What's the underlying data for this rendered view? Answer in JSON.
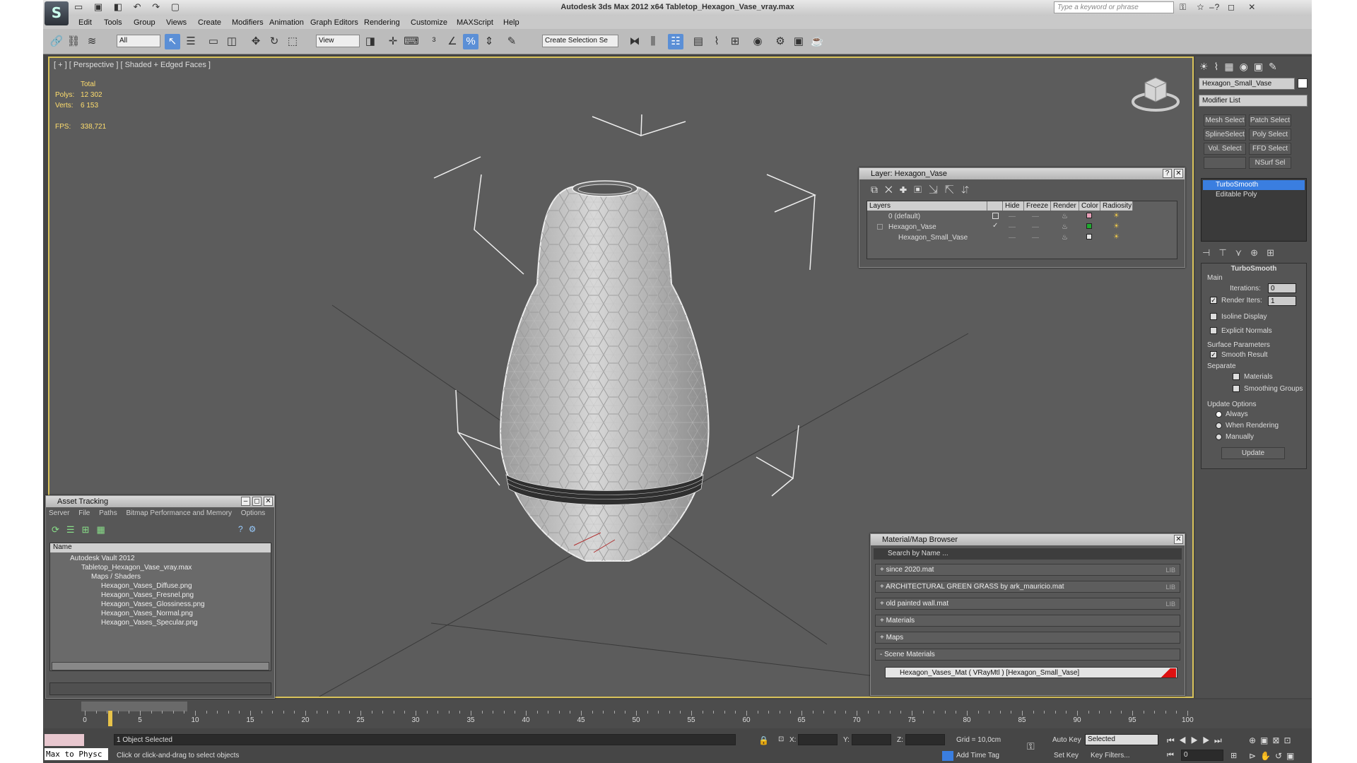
{
  "app": {
    "title": "Autodesk 3ds Max  2012 x64      Tabletop_Hexagon_Vase_vray.max",
    "search_placeholder": "Type a keyword or phrase",
    "logo_glyph": "S"
  },
  "menu": [
    "Edit",
    "Tools",
    "Group",
    "Views",
    "Create",
    "Modifiers",
    "Animation",
    "Graph Editors",
    "Rendering",
    "Customize",
    "MAXScript",
    "Help"
  ],
  "toolbar": {
    "selection_filter": "All",
    "reference_coord": "View",
    "named_selection": "Create Selection Se"
  },
  "viewport": {
    "label": "[ + ] [ Perspective ] [ Shaded + Edged Faces ]",
    "stats": {
      "total_label": "Total",
      "polys_label": "Polys:",
      "polys_value": "12 302",
      "verts_label": "Verts:",
      "verts_value": "6 153",
      "fps_label": "FPS:",
      "fps_value": "338,721"
    }
  },
  "command_panel": {
    "object_name": "Hexagon_Small_Vase",
    "modifier_list": "Modifier List",
    "buttons": [
      "Mesh Select",
      "Patch Select",
      "SplineSelect",
      "Poly Select",
      "Vol. Select",
      "FFD Select",
      "",
      "NSurf Sel"
    ],
    "stack": [
      "TurboSmooth",
      "Editable Poly"
    ],
    "turbosmooth": {
      "title": "TurboSmooth",
      "main": "Main",
      "iterations_label": "Iterations:",
      "iterations": "0",
      "render_iters_label": "Render Iters:",
      "render_iters": "1",
      "isoline": "Isoline Display",
      "explicit": "Explicit Normals",
      "surface_params": "Surface Parameters",
      "smooth_result": "Smooth Result",
      "separate": "Separate",
      "materials": "Materials",
      "smoothing_groups": "Smoothing Groups",
      "update_options": "Update Options",
      "always": "Always",
      "when_rendering": "When Rendering",
      "manually": "Manually",
      "update": "Update"
    }
  },
  "layer_window": {
    "title": "Layer: Hexagon_Vase",
    "columns": [
      "Layers",
      "",
      "Hide",
      "Freeze",
      "Render",
      "Color",
      "Radiosity"
    ],
    "rows": [
      {
        "name": "0 (default)",
        "color": "#e8a0b8"
      },
      {
        "name": "Hexagon_Vase",
        "color": "#1faa2f"
      },
      {
        "name": "Hexagon_Small_Vase",
        "color": "#e6e6e6"
      }
    ]
  },
  "asset_window": {
    "title": "Asset Tracking",
    "menu": [
      "Server",
      "File",
      "Paths",
      "Bitmap Performance and Memory",
      "Options"
    ],
    "col": "Name",
    "rows": [
      "Autodesk Vault 2012",
      "Tabletop_Hexagon_Vase_vray.max",
      "Maps / Shaders",
      "Hexagon_Vases_Diffuse.png",
      "Hexagon_Vases_Fresnel.png",
      "Hexagon_Vases_Glossiness.png",
      "Hexagon_Vases_Normal.png",
      "Hexagon_Vases_Specular.png"
    ]
  },
  "material_browser": {
    "title": "Material/Map Browser",
    "search": "Search by Name ...",
    "rows": [
      {
        "label": "+ since 2020.mat",
        "lib": "LIB"
      },
      {
        "label": "+ ARCHITECTURAL GREEN GRASS by ark_mauricio.mat",
        "lib": "LIB"
      },
      {
        "label": "+ old painted wall.mat",
        "lib": "LIB"
      },
      {
        "label": "+ Materials",
        "lib": ""
      },
      {
        "label": "+ Maps",
        "lib": ""
      },
      {
        "label": "- Scene Materials",
        "lib": ""
      }
    ],
    "scene_material": "Hexagon_Vases_Mat  ( VRayMtl )  [Hexagon_Small_Vase]"
  },
  "timeline": {
    "slider": "0 / 100",
    "ticks": [
      "0",
      "5",
      "10",
      "15",
      "20",
      "25",
      "30",
      "35",
      "40",
      "45",
      "50",
      "55",
      "60",
      "65",
      "70",
      "75",
      "80",
      "85",
      "90",
      "95",
      "100"
    ]
  },
  "status": {
    "maxscript": "Max to Physc",
    "selected": "1 Object Selected",
    "prompt": "Click or click-and-drag to select objects",
    "x_label": "X:",
    "y_label": "Y:",
    "z_label": "Z:",
    "grid": "Grid = 10,0cm",
    "add_time_tag": "Add Time Tag",
    "auto_key": "Auto Key",
    "set_key": "Set Key",
    "key_mode": "Selected",
    "key_filters": "Key Filters...",
    "frame": "0"
  }
}
